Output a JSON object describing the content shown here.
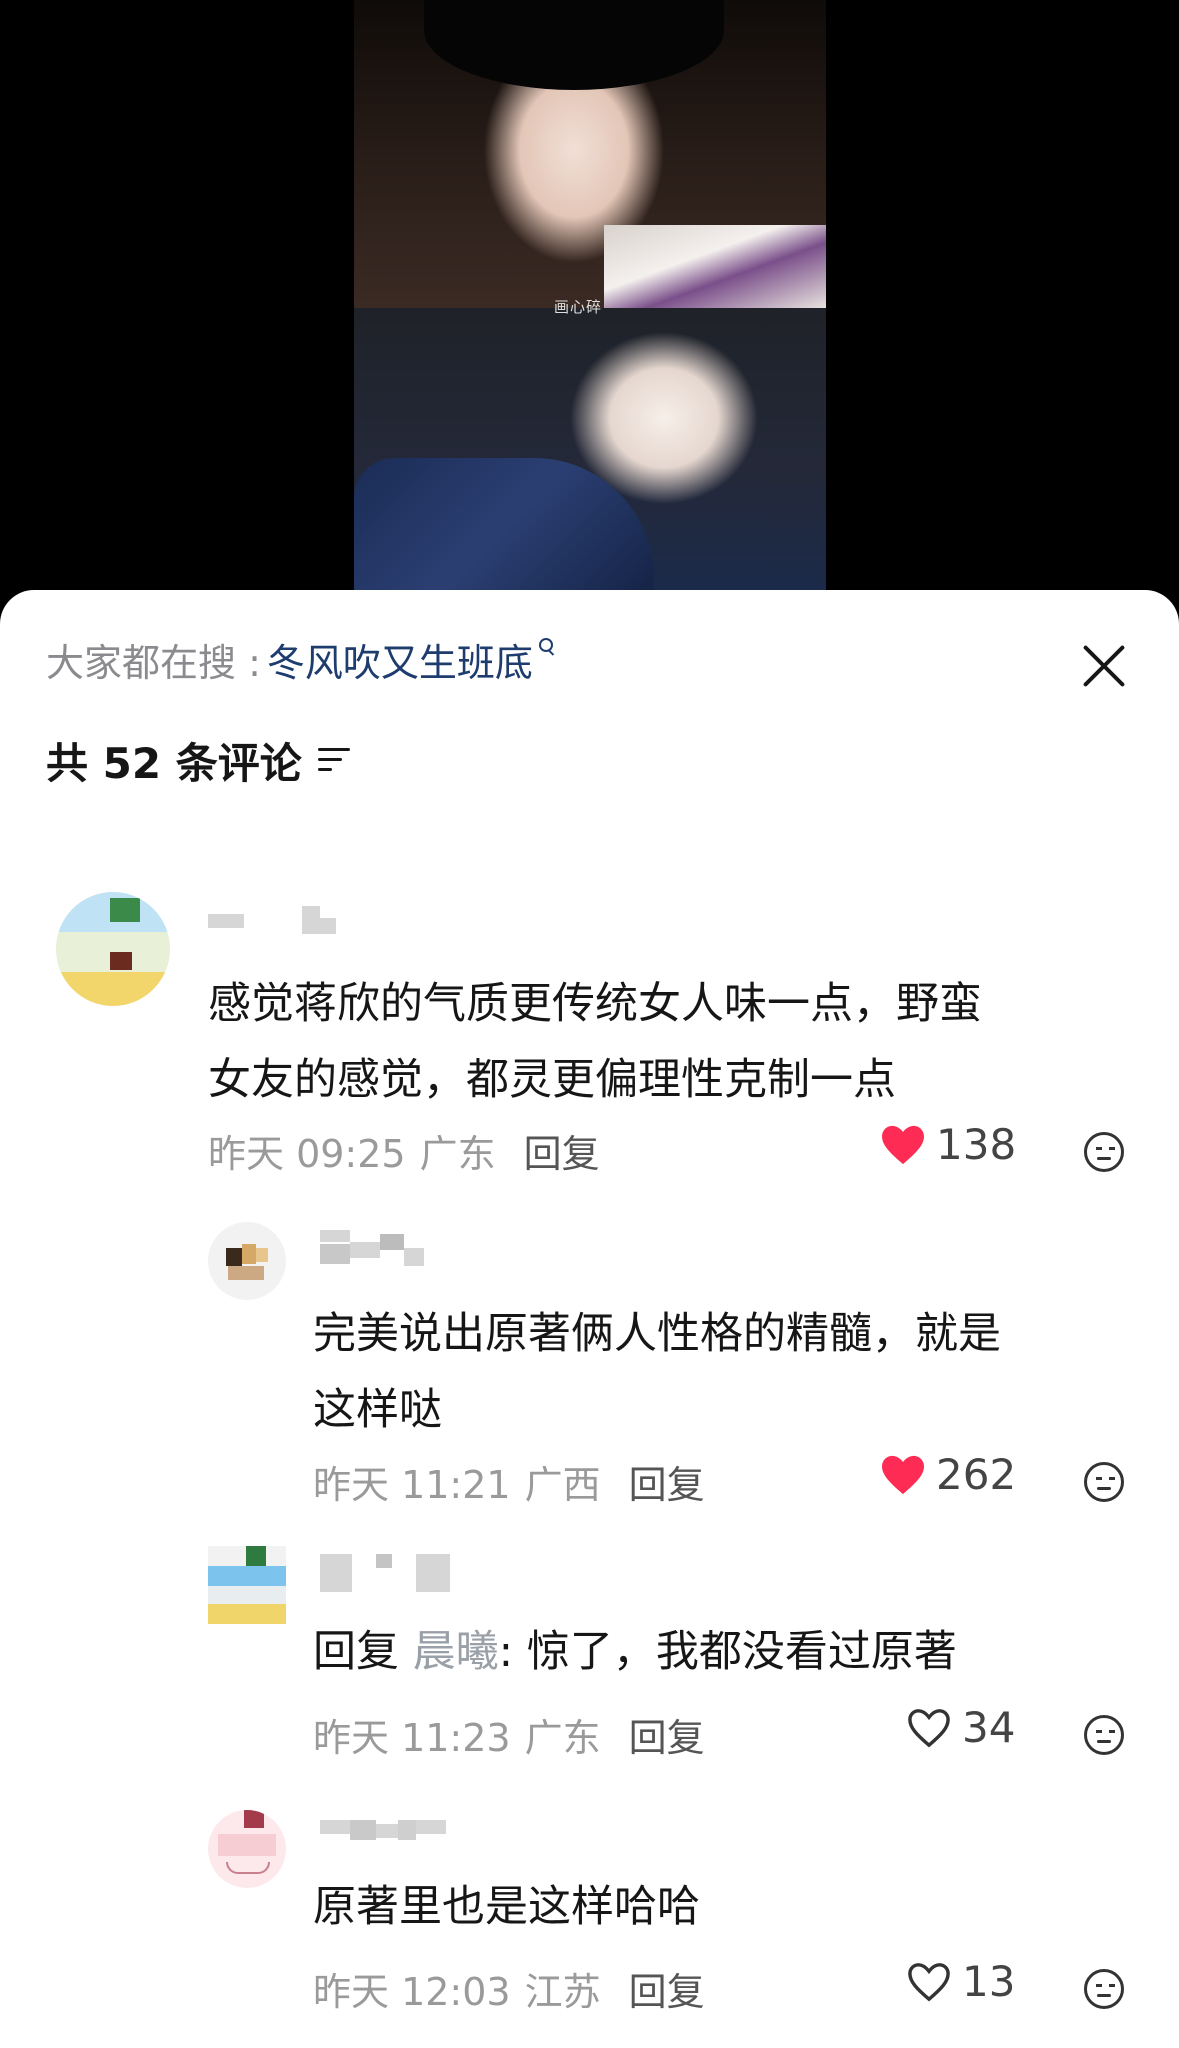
{
  "video": {
    "caption": "画心碎"
  },
  "search": {
    "prefix": "大家都在搜 : ",
    "term": "冬风吹又生班底"
  },
  "header": {
    "comment_count_label": "共 52 条评论"
  },
  "comments": [
    {
      "text_lines": [
        "感觉蒋欣的气质更传统女人味一点，野蛮",
        "女友的感觉，都灵更偏理性克制一点"
      ],
      "time": "昨天 09:25",
      "location": "广东",
      "reply_label": "回复",
      "likes": "138",
      "liked": true
    },
    {
      "text_lines": [
        "完美说出原著俩人性格的精髓，就是",
        "这样哒"
      ],
      "time": "昨天 11:21",
      "location": "广西",
      "reply_label": "回复",
      "likes": "262",
      "liked": true
    },
    {
      "reply_prefix": "回复 ",
      "reply_to": "晨曦",
      "text": ": 惊了，我都没看过原著",
      "time": "昨天 11:23",
      "location": "广东",
      "reply_label": "回复",
      "likes": "34",
      "liked": false
    },
    {
      "text": "原著里也是这样哈哈",
      "time": "昨天 12:03",
      "location": "江苏",
      "reply_label": "回复",
      "likes": "13",
      "liked": false
    }
  ],
  "colors": {
    "like_red": "#fe2c55",
    "search_term": "#1e3c6e"
  }
}
